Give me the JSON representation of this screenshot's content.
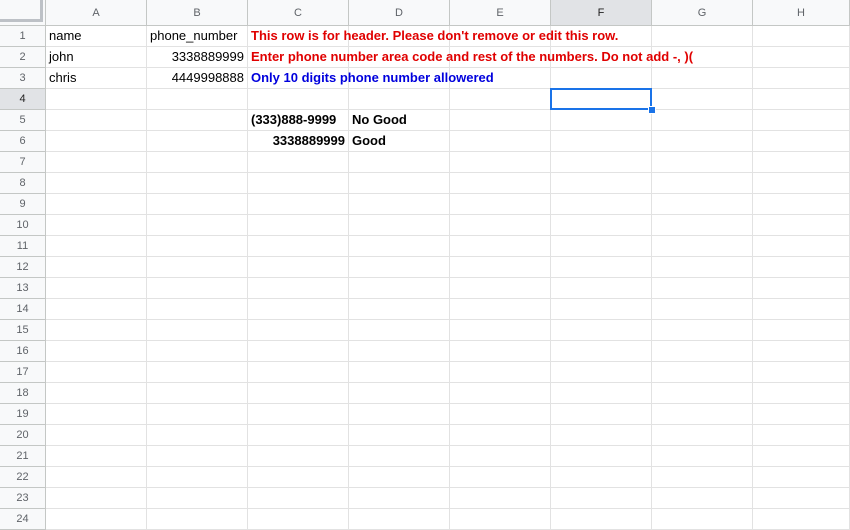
{
  "columns": [
    "A",
    "B",
    "C",
    "D",
    "E",
    "F",
    "G",
    "H"
  ],
  "rows": [
    "1",
    "2",
    "3",
    "4",
    "5",
    "6",
    "7",
    "8",
    "9",
    "10",
    "11",
    "12",
    "13",
    "14",
    "15",
    "16",
    "17",
    "18",
    "19",
    "20",
    "21",
    "22",
    "23",
    "24"
  ],
  "active_cell": {
    "col": "F",
    "row": "4"
  },
  "cells": {
    "A1": "name",
    "B1": "phone_number",
    "C1": "This row is for header. Please don't remove or edit this row.",
    "A2": "john",
    "B2": "3338889999",
    "C2": "Enter phone number area code and rest of the numbers. Do not add -, )(",
    "A3": "chris",
    "B3": "4449998888",
    "C3": "Only 10 digits phone number allowered",
    "C5": "(333)888-9999",
    "D5": "No Good",
    "C6": "3338889999",
    "D6": "Good"
  },
  "colors": {
    "note_red": "#e00000",
    "note_blue": "#0000dd",
    "selection": "#1a73e8"
  }
}
